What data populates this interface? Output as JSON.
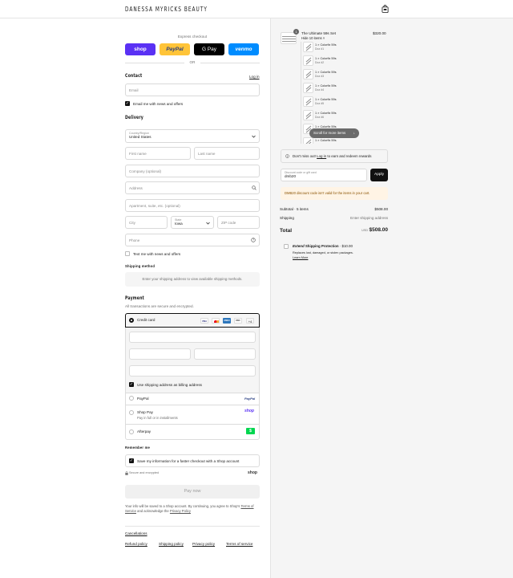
{
  "brand": "DANESSA MYRICKS BEAUTY",
  "express": {
    "title": "Express checkout",
    "shop": "shop",
    "paypal": "PayPal",
    "gpay": "G Pay",
    "venmo": "venmo",
    "or": "OR"
  },
  "contact": {
    "title": "Contact",
    "login": "Log in",
    "email_placeholder": "Email",
    "news_label": "Email me with news and offers"
  },
  "delivery": {
    "title": "Delivery",
    "country_label": "Country/Region",
    "country_value": "United States",
    "first": "First name",
    "last": "Last name",
    "company": "Company (optional)",
    "address": "Address",
    "apartment": "Apartment, suite, etc. (optional)",
    "city": "City",
    "state_label": "State",
    "state_value": "Iowa",
    "zip": "ZIP code",
    "phone": "Phone",
    "text_label": "Text me with news and offers"
  },
  "shipping_method": {
    "title": "Shipping method",
    "note": "Enter your shipping address to view available shipping methods."
  },
  "payment": {
    "title": "Payment",
    "subtitle": "All transactions are secure and encrypted.",
    "credit_card": "Credit card",
    "cards": [
      "VISA",
      "MC",
      "AMEX",
      "DISC"
    ],
    "more_cards": "+4",
    "billing_label": "Use shipping address as billing address",
    "paypal": "PayPal",
    "paypal_logo": "PayPal",
    "shoppay": "Shop Pay",
    "shoppay_sub": "Pay in full or in installments",
    "shoppay_logo": "shop",
    "afterpay": "Afterpay",
    "afterpay_logo": "$"
  },
  "remember": {
    "title": "Remember me",
    "label": "Save my information for a faster checkout with a Shop account",
    "secure": "Secure and encrypted",
    "shop_logo": "shop"
  },
  "pay_now": "Pay now",
  "disclaimer": {
    "text1": "Your info will be saved to a Shop account. By continuing, you agree to Shop's",
    "tos": "Terms of Service",
    "and": "and acknowledge the",
    "privacy": "Privacy Policy"
  },
  "footer": {
    "cancellations": "Cancellations",
    "links": [
      "Refund policy",
      "Shipping policy",
      "Privacy policy",
      "Terms of service"
    ]
  },
  "summary": {
    "product_name": "The Ultimate 59s Set",
    "qty_badge": "1",
    "price": "$320.00",
    "hide_items": "Hide 10 items",
    "sub_items": [
      {
        "name": "1 × Colorfix 59s",
        "variant": "Doz #1"
      },
      {
        "name": "1 × Colorfix 59s",
        "variant": "Doz #2"
      },
      {
        "name": "1 × Colorfix 59s",
        "variant": "Doz #3"
      },
      {
        "name": "1 × Colorfix 59s",
        "variant": "Doz #4"
      },
      {
        "name": "1 × Colorfix 59s",
        "variant": "Doz #5"
      },
      {
        "name": "1 × Colorfix 59s",
        "variant": "Doz #6"
      },
      {
        "name": "1 × Colorfix 59s",
        "variant": ""
      },
      {
        "name": "1 × Colorfix 59s",
        "variant": ""
      }
    ],
    "scroll_hint": "Scroll for more items",
    "rewards": {
      "pre": "Don't miss out!",
      "link": "Log in",
      "post": "to earn and redeem rewards"
    },
    "discount_label": "Discount code or gift card",
    "discount_value": "dmb20",
    "apply": "Apply",
    "error": "DMB20 discount code isn't valid for the items in your cart.",
    "subtotal_label": "Subtotal · 5 items",
    "subtotal": "$508.00",
    "shipping_label": "Shipping",
    "shipping_value": "Enter shipping address",
    "total_label": "Total",
    "currency": "USD",
    "total": "$508.00",
    "protection": {
      "brand": "Extend",
      "title": "Shipping Protection",
      "price": "· $10.00",
      "desc": "Replaces lost, damaged, or stolen packages.",
      "learn": "Learn More"
    }
  },
  "colors": {
    "shop": "#5a31f4",
    "paypal": "#ffc439",
    "gpay": "#000000",
    "venmo": "#008cff",
    "error_bg": "#fff4e5",
    "afterpay": "#00d64f"
  }
}
